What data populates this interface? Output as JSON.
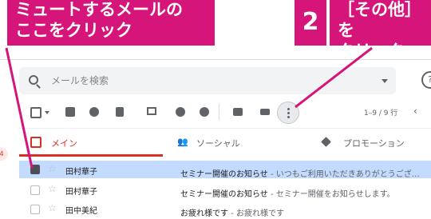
{
  "callouts": {
    "left_text_line1": "ミュートするメールの",
    "left_text_line2": "ここをクリック",
    "step_number": "2",
    "right_text_line1": "［その他］を",
    "right_text_line2": "クリック",
    "color": "#d6157a"
  },
  "search": {
    "placeholder": "メールを検索"
  },
  "toolbar": {
    "page_count": "1–9 / 9 行"
  },
  "tabs": [
    {
      "label": "メイン",
      "active": true,
      "icon": "inbox-icon"
    },
    {
      "label": "ソーシャル",
      "active": false,
      "icon": "people-icon"
    },
    {
      "label": "プロモーション",
      "active": false,
      "icon": "tag-icon"
    }
  ],
  "badge": "4",
  "emails": [
    {
      "sender": "田村華子",
      "subject": "セミナー開催のお知らせ",
      "snippet": " - いつもご利用いただきありがとうござ…",
      "selected": true
    },
    {
      "sender": "田村華子",
      "subject": "セミナー開催のお知らせ",
      "snippet": " - セミナー開催をお知らせします。",
      "selected": false
    },
    {
      "sender": "田中美紀",
      "subject": "お疲れ様です",
      "snippet": " - お疲れ様です",
      "selected": false
    }
  ],
  "colors": {
    "accent_red": "#d93025",
    "selected_row": "#c2dbff"
  }
}
